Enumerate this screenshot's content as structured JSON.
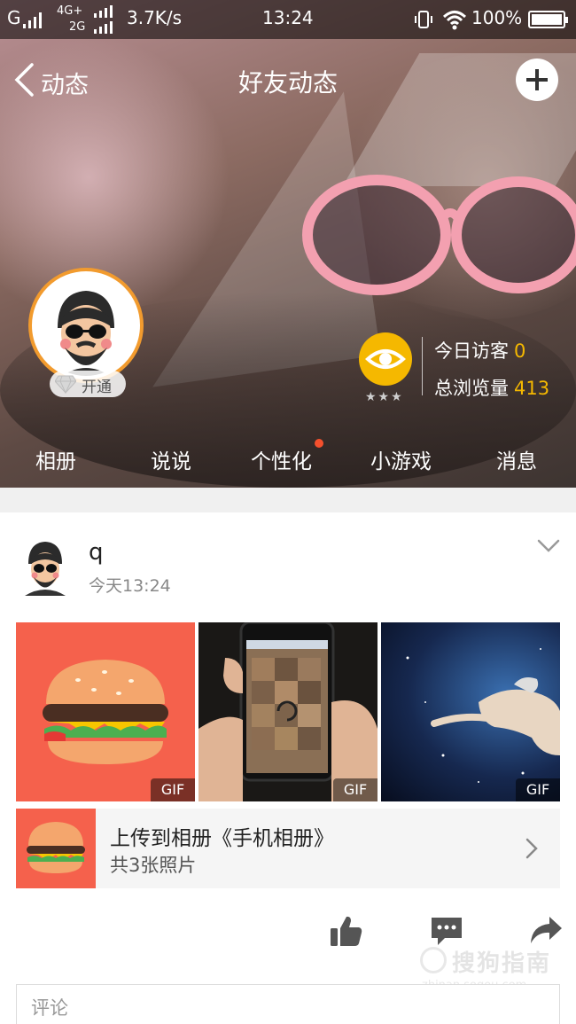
{
  "status_bar": {
    "carrier1": "G",
    "net_top": "4G+",
    "net_bottom": "2G",
    "speed": "3.7K/s",
    "time": "13:24",
    "battery": "100%"
  },
  "nav": {
    "back_label": "动态",
    "title": "好友动态"
  },
  "profile": {
    "vip_label": "开通",
    "visitors_today_label": "今日访客",
    "visitors_today_value": "0",
    "total_views_label": "总浏览量",
    "total_views_value": "413",
    "stars": "★★★"
  },
  "hero_tabs": [
    {
      "label": "相册"
    },
    {
      "label": "说说"
    },
    {
      "label": "个性化",
      "badge": true
    },
    {
      "label": "小游戏"
    },
    {
      "label": "消息"
    }
  ],
  "post": {
    "username": "q",
    "time": "今天13:24",
    "photos": [
      {
        "tag": "GIF",
        "subject": "burger"
      },
      {
        "tag": "GIF",
        "subject": "phone"
      },
      {
        "tag": "GIF",
        "subject": "space"
      }
    ],
    "album_title": "上传到相册《手机相册》",
    "album_subtitle": "共3张照片",
    "comment_placeholder": "评论"
  },
  "watermark": {
    "brand": "搜狗指南",
    "url": "zhinan.sogou.com"
  },
  "colors": {
    "accent_orange": "#f5b800",
    "badge_red": "#f5502d",
    "burger_bg": "#f5614c"
  }
}
